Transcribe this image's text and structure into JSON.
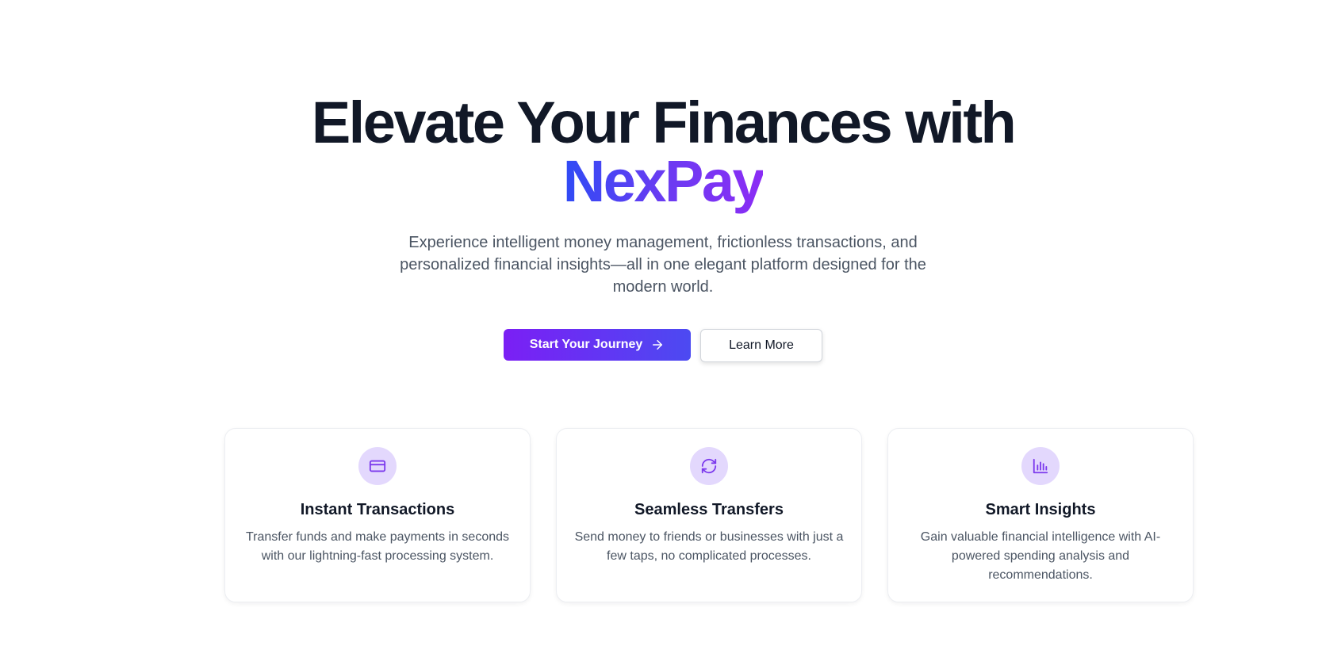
{
  "hero": {
    "headline_line1": "Elevate Your Finances with",
    "headline_brand": "NexPay",
    "subtitle": "Experience intelligent money management, frictionless transactions, and personalized financial insights—all in one elegant platform designed for the modern world.",
    "primary_button_label": "Start Your Journey",
    "secondary_button_label": "Learn More"
  },
  "features": [
    {
      "icon": "credit-card-icon",
      "title": "Instant Transactions",
      "description": "Transfer funds and make payments in seconds with our lightning-fast processing system."
    },
    {
      "icon": "refresh-icon",
      "title": "Seamless Transfers",
      "description": "Send money to friends or businesses with just a few taps, no complicated processes."
    },
    {
      "icon": "bar-chart-icon",
      "title": "Smart Insights",
      "description": "Gain valuable financial intelligence with AI-powered spending analysis and recommendations."
    }
  ],
  "colors": {
    "heading": "#111827",
    "body_text": "#4b5563",
    "brand_gradient_start": "#2f4bf5",
    "brand_gradient_end": "#8b2cf5",
    "icon_bg": "#e3d8fd",
    "icon_stroke": "#7c3aed"
  }
}
